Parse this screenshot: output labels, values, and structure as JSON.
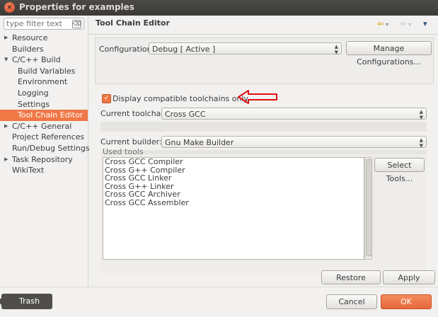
{
  "window": {
    "title": "Properties for examples",
    "close_glyph": "×"
  },
  "sidebar": {
    "filter_placeholder": "type filter text",
    "items": [
      {
        "label": "Resource",
        "arrow": "▶"
      },
      {
        "label": "Builders",
        "arrow": ""
      },
      {
        "label": "C/C++ Build",
        "arrow": "▼"
      },
      {
        "label": "Build Variables",
        "arrow": ""
      },
      {
        "label": "Environment",
        "arrow": ""
      },
      {
        "label": "Logging",
        "arrow": ""
      },
      {
        "label": "Settings",
        "arrow": ""
      },
      {
        "label": "Tool Chain Editor",
        "arrow": ""
      },
      {
        "label": "C/C++ General",
        "arrow": "▶"
      },
      {
        "label": "Project References",
        "arrow": ""
      },
      {
        "label": "Run/Debug Settings",
        "arrow": ""
      },
      {
        "label": "Task Repository",
        "arrow": "▶"
      },
      {
        "label": "WikiText",
        "arrow": ""
      }
    ],
    "selected": "Tool Chain Editor"
  },
  "header": {
    "title": "Tool Chain Editor",
    "back_icon": "⇦",
    "forward_icon": "⇨",
    "menu_icon": "▾"
  },
  "configuration": {
    "label": "Configuration:",
    "value": "Debug  [ Active ]",
    "manage_label": "Manage Configurations..."
  },
  "options": {
    "display_compatible_label": "Display compatible toolchains only",
    "display_compatible_checked": true,
    "current_toolchain_label": "Current toolchain:",
    "current_toolchain_value": "Cross GCC",
    "current_builder_label": "Current builder:",
    "current_builder_value": "Gnu Make Builder"
  },
  "used_tools": {
    "label": "Used tools",
    "items": [
      "Cross GCC Compiler",
      "Cross G++ Compiler",
      "Cross GCC Linker",
      "Cross G++ Linker",
      "Cross GCC Archiver",
      "Cross GCC Assembler"
    ],
    "select_tools_label": "Select Tools..."
  },
  "buttons": {
    "restore_defaults": "Restore Defaults",
    "apply": "Apply",
    "cancel": "Cancel",
    "ok": "OK"
  },
  "trash": {
    "label": "Trash"
  },
  "colors": {
    "accent": "#f07746",
    "annotation_arrow": "#e01010"
  }
}
